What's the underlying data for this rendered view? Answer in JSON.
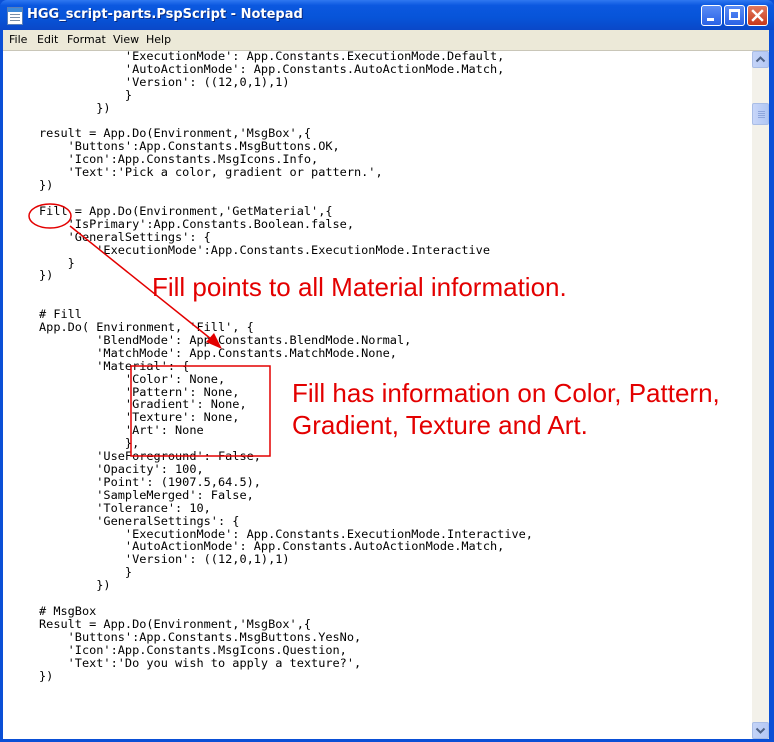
{
  "window": {
    "title": "HGG_script-parts.PspScript - Notepad",
    "icon": "notepad-icon",
    "controls": [
      "minimize-icon",
      "maximize-icon",
      "close-icon"
    ]
  },
  "menu": [
    "File",
    "Edit",
    "Format",
    "View",
    "Help"
  ],
  "editor": {
    "lines": [
      "            'ExecutionMode': App.Constants.ExecutionMode.Default,",
      "            'AutoActionMode': App.Constants.AutoActionMode.Match,",
      "            'Version': ((12,0,1),1)",
      "            }",
      "        })",
      "",
      "result = App.Do(Environment,'MsgBox',{",
      "    'Buttons':App.Constants.MsgButtons.OK,",
      "    'Icon':App.Constants.MsgIcons.Info,",
      "    'Text':'Pick a color, gradient or pattern.',",
      "})",
      "",
      "Fill = App.Do(Environment,'GetMaterial',{",
      "    'IsPrimary':App.Constants.Boolean.false,",
      "    'GeneralSettings': {",
      "        'ExecutionMode':App.Constants.ExecutionMode.Interactive",
      "    }",
      "})",
      "",
      "",
      "# Fill",
      "App.Do( Environment, 'Fill', {",
      "        'BlendMode': App.Constants.BlendMode.Normal,",
      "        'MatchMode': App.Constants.MatchMode.None,",
      "        'Material': {",
      "            'Color': None,",
      "            'Pattern': None,",
      "            'Gradient': None,",
      "            'Texture': None,",
      "            'Art': None",
      "            },",
      "        'UseForeground': False,",
      "        'Opacity': 100,",
      "        'Point': (1907.5,64.5),",
      "        'SampleMerged': False,",
      "        'Tolerance': 10,",
      "        'GeneralSettings': {",
      "            'ExecutionMode': App.Constants.ExecutionMode.Interactive,",
      "            'AutoActionMode': App.Constants.AutoActionMode.Match,",
      "            'Version': ((12,0,1),1)",
      "            }",
      "        })",
      "",
      "# MsgBox",
      "Result = App.Do(Environment,'MsgBox',{",
      "    'Buttons':App.Constants.MsgButtons.YesNo,",
      "    'Icon':App.Constants.MsgIcons.Question,",
      "    'Text':'Do you wish to apply a texture?',",
      "})"
    ]
  },
  "annotations": {
    "fill_points": "Fill points to all Material information.",
    "fill_info_line1": "Fill has information on Color, Pattern,",
    "fill_info_line2": "Gradient, Texture and Art.",
    "color": "#e30000"
  },
  "scrollbar": {
    "up": "scroll-up-arrow-icon",
    "down": "scroll-down-arrow-icon"
  }
}
